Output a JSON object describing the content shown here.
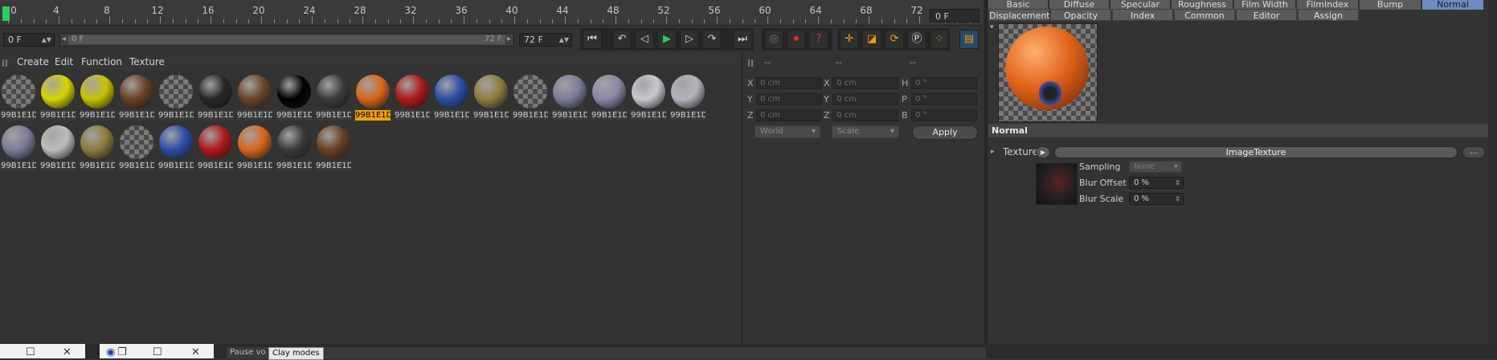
{
  "timeline": {
    "ruler_labels": [
      "0",
      "4",
      "8",
      "12",
      "16",
      "20",
      "24",
      "28",
      "32",
      "36",
      "40",
      "44",
      "48",
      "52",
      "56",
      "60",
      "64",
      "68",
      "72"
    ],
    "end_frame_display": "0 F",
    "start_field": "0 F",
    "range_start": "0 F",
    "range_end": "72 F",
    "end_field": "72 F",
    "playhead_frame": 0
  },
  "material_manager": {
    "menu": [
      "Create",
      "Edit",
      "Function",
      "Texture"
    ],
    "materials": [
      {
        "name": "99B1E1D",
        "sphere": "checker",
        "selected": false
      },
      {
        "name": "99B1E1D",
        "sphere": "#d8d400",
        "selected": false
      },
      {
        "name": "99B1E1D",
        "sphere": "#c8c400",
        "selected": false
      },
      {
        "name": "99B1E1D",
        "sphere": "#6b4024",
        "selected": false
      },
      {
        "name": "99B1E1D",
        "sphere": "checker",
        "selected": false
      },
      {
        "name": "99B1E1D",
        "sphere": "#262626",
        "selected": false
      },
      {
        "name": "99B1E1D",
        "sphere": "#6a4428",
        "selected": false
      },
      {
        "name": "99B1E1D",
        "sphere": "#000000",
        "selected": false
      },
      {
        "name": "99B1E1D",
        "sphere": "#3a3a3a",
        "selected": false
      },
      {
        "name": "99B1E1D",
        "sphere": "#d8661a",
        "selected": true
      },
      {
        "name": "99B1E1D",
        "sphere": "#b01818",
        "selected": false
      },
      {
        "name": "99B1E1D",
        "sphere": "#2a4ea8",
        "selected": false
      },
      {
        "name": "99B1E1D",
        "sphere": "#8c7f3c",
        "selected": false
      },
      {
        "name": "99B1E1D",
        "sphere": "checker",
        "selected": false
      },
      {
        "name": "99B1E1D",
        "sphere": "#7c7c9a",
        "selected": false
      },
      {
        "name": "99B1E1D",
        "sphere": "#8a8aa6",
        "selected": false
      },
      {
        "name": "99B1E1D",
        "sphere": "#c8c8d0",
        "selected": false
      },
      {
        "name": "99B1E1D",
        "sphere": "#b4b4be",
        "selected": false
      },
      {
        "name": "99B1E1D",
        "sphere": "#7c7c9a",
        "selected": false
      },
      {
        "name": "99B1E1D",
        "sphere": "#bdbdbd",
        "selected": false
      },
      {
        "name": "99B1E1D",
        "sphere": "#8a7d3c",
        "selected": false
      },
      {
        "name": "99B1E1D",
        "sphere": "checker",
        "selected": false
      },
      {
        "name": "99B1E1D",
        "sphere": "#2a4ea8",
        "selected": false
      },
      {
        "name": "99B1E1D",
        "sphere": "#b01818",
        "selected": false
      },
      {
        "name": "99B1E1D",
        "sphere": "#d8661a",
        "selected": false
      },
      {
        "name": "99B1E1D",
        "sphere": "#3a3a3a",
        "selected": false
      },
      {
        "name": "99B1E1D",
        "sphere": "#6b4024",
        "selected": false
      }
    ]
  },
  "coordinates": {
    "headers": [
      "--",
      "--",
      "--"
    ],
    "rows": [
      {
        "l1": "X",
        "v1": "0 cm",
        "l2": "X",
        "v2": "0 cm",
        "l3": "H",
        "v3": "0 °"
      },
      {
        "l1": "Y",
        "v1": "0 cm",
        "l2": "Y",
        "v2": "0 cm",
        "l3": "P",
        "v3": "0 °"
      },
      {
        "l1": "Z",
        "v1": "0 cm",
        "l2": "Z",
        "v2": "0 cm",
        "l3": "B",
        "v3": "0 °"
      }
    ],
    "space_dropdown": "World",
    "mode_dropdown": "Scale",
    "apply_label": "Apply"
  },
  "attributes": {
    "tabs_row1": [
      "Basic",
      "Diffuse",
      "Specular",
      "Roughness",
      "Film Width",
      "FilmIndex",
      "Bump",
      "Normal"
    ],
    "tabs_row2": [
      "Displacement",
      "Opacity",
      "Index",
      "Common",
      "Editor",
      "Assign"
    ],
    "section_title": "Normal",
    "texture_label": "Texture",
    "texture_value": "ImageTexture",
    "more_button": "...",
    "sampling_label": "Sampling",
    "sampling_value": "None",
    "blur_offset_label": "Blur Offset",
    "blur_offset_value": "0 %",
    "blur_scale_label": "Blur Scale",
    "blur_scale_value": "0 %"
  },
  "status": {
    "pause_label": "Pause vo",
    "clay_label": "Clay modes"
  },
  "colors": {
    "accent_selected": "#f0a000",
    "play_green": "#2ccf5a",
    "snap_orange": "#f0a000"
  }
}
